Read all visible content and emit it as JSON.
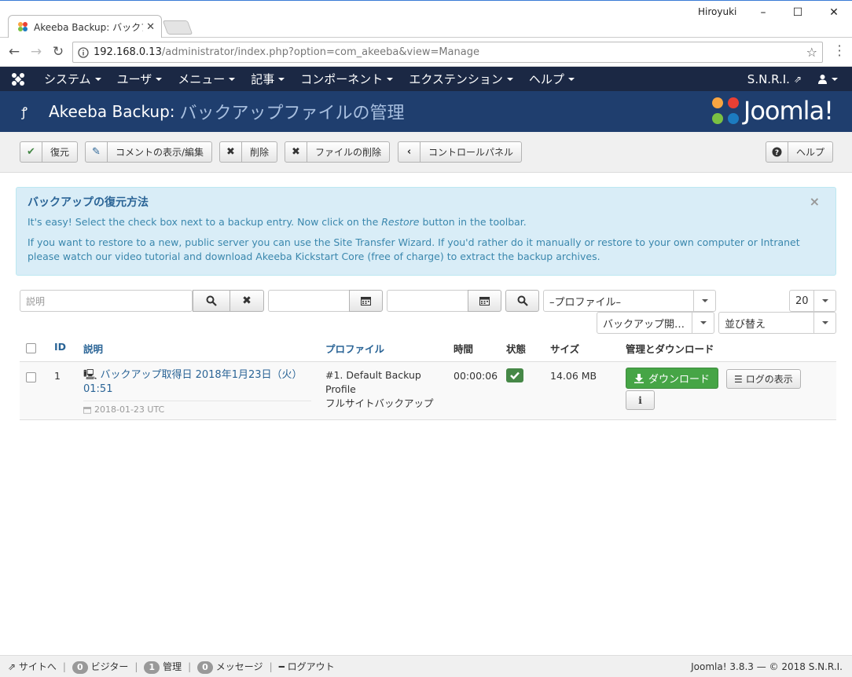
{
  "browser": {
    "tab_title": "Akeeba Backup: バックア",
    "user": "Hiroyuki",
    "url_host": "192.168.0.13",
    "url_path": "/administrator/index.php?option=com_akeeba&view=Manage"
  },
  "nav": {
    "items": [
      "システム",
      "ユーザ",
      "メニュー",
      "記事",
      "コンポーネント",
      "エクステンション",
      "ヘルプ"
    ],
    "site_name": "S.N.R.I."
  },
  "header": {
    "title_main": "Akeeba Backup:",
    "title_sub": "バックアップファイルの管理",
    "logo_text": "Joomla!"
  },
  "toolbar": {
    "restore": "復元",
    "comment": "コメントの表示/編集",
    "delete": "削除",
    "delete_files": "ファイルの削除",
    "control_panel": "コントロールパネル",
    "help": "ヘルプ"
  },
  "alert": {
    "title": "バックアップの復元方法",
    "line1_a": "It's easy! Select the check box next to a backup entry. Now click on the ",
    "line1_em": "Restore",
    "line1_b": " button in the toolbar.",
    "line2": "If you want to restore to a new, public server you can use the Site Transfer Wizard. If you'd rather do it manually or restore to your own computer or Intranet please watch our video tutorial and download Akeeba Kickstart Core (free of charge) to extract the backup archives."
  },
  "filters": {
    "search_placeholder": "説明",
    "profile_select": "–プロファイル–",
    "limit": "20",
    "sort_select": "バックアップ開…",
    "order_select": "並び替え"
  },
  "table": {
    "headers": {
      "id": "ID",
      "desc": "説明",
      "profile": "プロファイル",
      "time": "時間",
      "status": "状態",
      "size": "サイズ",
      "manage": "管理とダウンロード"
    },
    "row": {
      "id": "1",
      "desc": "バックアップ取得日 2018年1月23日（火）01:51",
      "date": "2018-01-23 UTC",
      "profile": "#1. Default Backup Profile",
      "type": "フルサイトバックアップ",
      "duration": "00:00:06",
      "size": "14.06 MB",
      "download": "ダウンロード",
      "view_log": "ログの表示",
      "info": "i"
    }
  },
  "statusbar": {
    "site": "サイトへ",
    "visitors_count": "0",
    "visitors": "ビジター",
    "admins_count": "1",
    "admins": "管理",
    "messages_count": "0",
    "messages": "メッセージ",
    "logout": "ログアウト",
    "version": "Joomla! 3.8.3 — © 2018 S.N.R.I."
  }
}
